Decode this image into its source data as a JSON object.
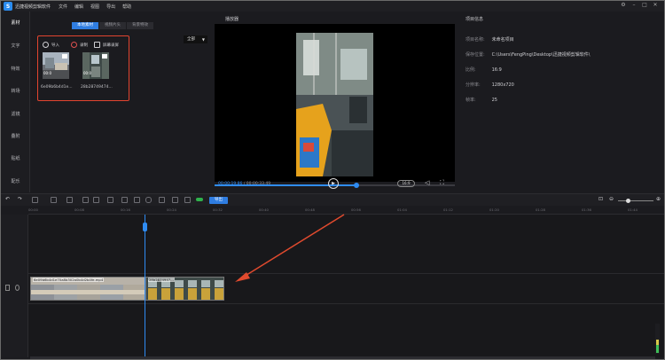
{
  "app": {
    "title": "迅捷视频剪辑软件",
    "logo_letter": "S",
    "menu": [
      "文件",
      "编辑",
      "视图",
      "导出",
      "帮助"
    ],
    "window_controls": [
      "⚙",
      "–",
      "□",
      "✕"
    ]
  },
  "left_nav": [
    "素材",
    "文字",
    "特效",
    "转场",
    "滤镜",
    "叠附",
    "贴纸",
    "配乐"
  ],
  "library": {
    "tabs": [
      "本地素材",
      "视频片头",
      "背景特效"
    ],
    "active_tab": 0,
    "actions": {
      "import": "导入",
      "record": "录制",
      "screen_record": "屏幕录屏"
    },
    "items": [
      {
        "name": "6e09b6b4d1e...",
        "duration": "00:0"
      },
      {
        "name": "28b28749474...",
        "duration": "00:0"
      }
    ],
    "filter": "全部"
  },
  "player": {
    "title": "播放器",
    "current_time": "00:00:19.86",
    "total_time": "00:00:33.49",
    "progress": 0.59,
    "ratio": "16:9"
  },
  "project_info": {
    "title": "项目信息",
    "rows": [
      {
        "key": "项目名称:",
        "value": "未命名项目"
      },
      {
        "key": "保存位置:",
        "value": "C:\\Users\\FengPing\\Desktop\\迅捷视频剪辑软件\\"
      },
      {
        "key": "比例:",
        "value": "16:9"
      },
      {
        "key": "分辨率:",
        "value": "1280x720"
      },
      {
        "key": "帧率:",
        "value": "25"
      }
    ]
  },
  "toolbar": {
    "export_label": "导出"
  },
  "ruler": {
    "ticks": [
      "00:00",
      "00:08",
      "00:16",
      "00:24",
      "00:32",
      "00:40",
      "00:48",
      "00:56",
      "01:04",
      "01:12",
      "01:20",
      "01:28",
      "01:36",
      "01:44"
    ]
  },
  "timeline": {
    "clips": [
      {
        "label": "6e09b6b4d1e70a8b302a0b4d2b4fe.mp4"
      },
      {
        "label": "28b2874947..."
      }
    ]
  },
  "colors": {
    "accent": "#2f7de1",
    "highlight_border": "#e2442f",
    "arrow": "#e04a2e"
  }
}
